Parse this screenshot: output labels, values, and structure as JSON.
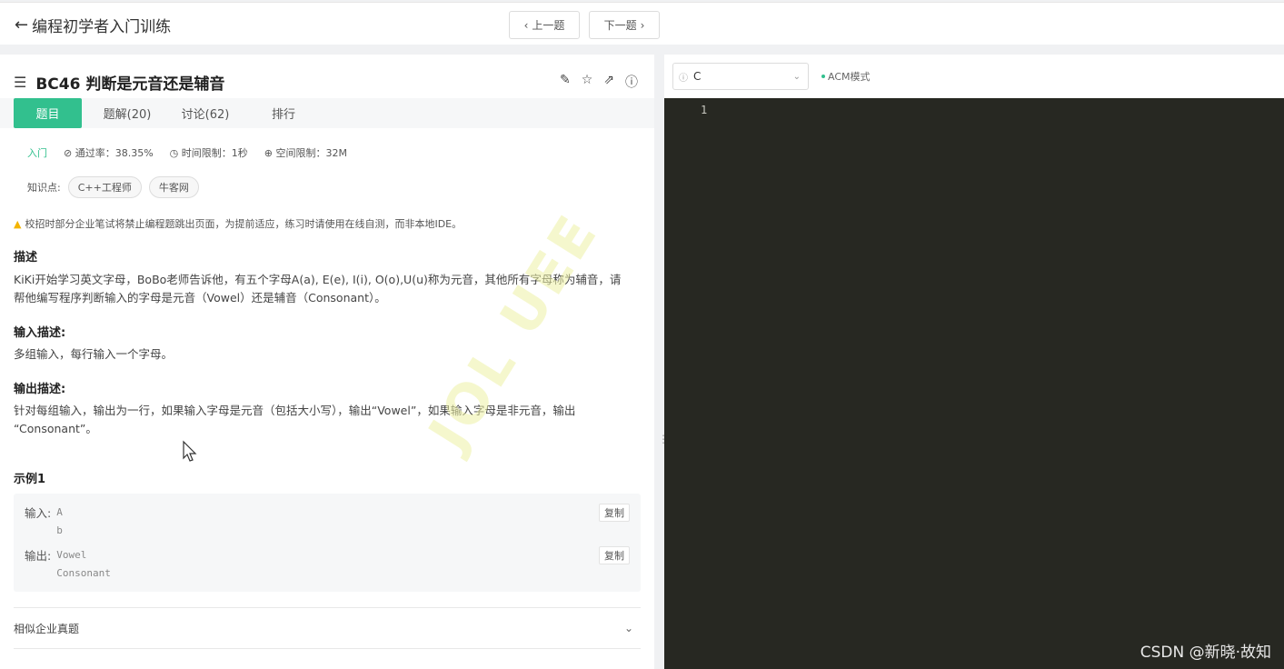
{
  "topbar": {
    "back_label": "编程初学者入门训练",
    "prev_label": "上一题",
    "next_label": "下一题"
  },
  "question": {
    "title": "BC46  判断是元音还是辅音",
    "tabs": [
      "题目",
      "题解(20)",
      "讨论(62)",
      "排行"
    ],
    "active_tab": 0,
    "level": "入门",
    "pass_rate": "通过率：38.35%",
    "time_limit": "时间限制：1秒",
    "space_limit": "空间限制：32M",
    "knowledge_label": "知识点:",
    "tags": [
      "C++工程师",
      "牛客网"
    ],
    "warning": "校招时部分企业笔试将禁止编程题跳出页面，为提前适应，练习时请使用在线自测，而非本地IDE。",
    "desc_heading": "描述",
    "desc_line1": "KiKi开始学习英文字母，BoBo老师告诉他，有五个字母A(a), E(e), I(i), O(o),U(u)称为元音，其他所有字母称为辅音，请",
    "desc_line2": "帮他编写程序判断输入的字母是元音（Vowel）还是辅音（Consonant）。",
    "input_heading": "输入描述:",
    "input_text": "多组输入，每行输入一个字母。",
    "output_heading": "输出描述:",
    "output_line1": "针对每组输入，输出为一行，如果输入字母是元音（包括大小写），输出“Vowel”，如果输入字母是非元音，输出",
    "output_line2": "“Consonant”。",
    "example_heading": "示例1",
    "example": {
      "input_label": "输入:",
      "input_value": "A\nb",
      "output_label": "输出:",
      "output_value": "Vowel\nConsonant",
      "copy_label": "复制"
    },
    "similar_label": "相似企业真题"
  },
  "editor": {
    "language": "C",
    "mode": "ACM模式",
    "line_number": "1"
  },
  "watermark": "JOL UEE",
  "credit": "CSDN @新晓·故知",
  "colors": {
    "accent": "#32c08e",
    "editor_bg": "#272822"
  }
}
